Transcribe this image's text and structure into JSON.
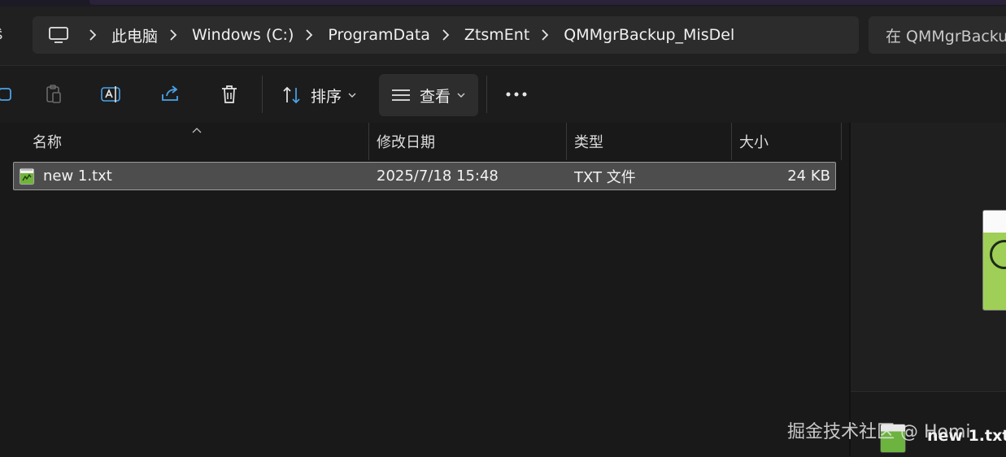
{
  "address": {
    "crumbs": [
      "此电脑",
      "Windows (C:)",
      "ProgramData",
      "ZtsmEnt",
      "QMMgrBackup_MisDel"
    ],
    "search_placeholder": "在 QMMgrBackup_MisDel 中搜索",
    "nav_fragment": "ŝ"
  },
  "toolbar": {
    "sort_label": "排序",
    "view_label": "查看",
    "icons": [
      "copy-icon",
      "paste-icon",
      "rename-icon",
      "share-icon",
      "delete-icon",
      "sort-icon",
      "view-icon",
      "more-icon"
    ]
  },
  "columns": {
    "name": "名称",
    "date": "修改日期",
    "type": "类型",
    "size": "大小"
  },
  "files": [
    {
      "name": "new 1.txt",
      "date": "2025/7/18 15:48",
      "type": "TXT 文件",
      "size": "24 KB",
      "selected": true
    }
  ],
  "preview": {
    "file_name": "new 1.txt"
  },
  "watermark": "掘金技术社区 @ Homi",
  "colors": {
    "background": "#191919",
    "selection": "#4d4d4d",
    "address_bg": "#2c2c2c"
  }
}
